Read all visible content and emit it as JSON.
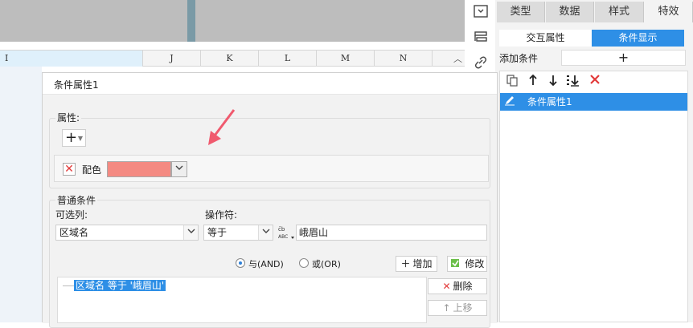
{
  "spreadsheet": {
    "columns": [
      "I",
      "J",
      "K",
      "L",
      "M",
      "N"
    ]
  },
  "right_panel": {
    "top_tabs": [
      "类型",
      "数据",
      "样式",
      "特效"
    ],
    "sub_tabs": [
      "交互属性",
      "条件显示"
    ],
    "add_condition_label": "添加条件",
    "add_condition_button": "+",
    "selected_item": "条件属性1"
  },
  "dialog": {
    "title": "条件属性1",
    "attribute_section": {
      "legend": "属性:",
      "add_button": "+",
      "color_label": "配色",
      "color_value": "#f48a82"
    },
    "condition_section": {
      "legend": "普通条件",
      "column_label": "可选列:",
      "column_value": "区域名",
      "operator_label": "操作符:",
      "operator_value": "等于",
      "value_input": "峨眉山",
      "radio_and": "与(AND)",
      "radio_or": "或(OR)",
      "add_btn": "增加",
      "modify_btn": "修改",
      "delete_btn": "删除",
      "move_up_btn": "上移",
      "condition_item": "区域名 等于 '峨眉山'"
    }
  },
  "colors": {
    "accent": "#2e8fe6",
    "delete_red": "#e23a3a",
    "swatch": "#f48a82",
    "arrow": "#f05a6e"
  }
}
